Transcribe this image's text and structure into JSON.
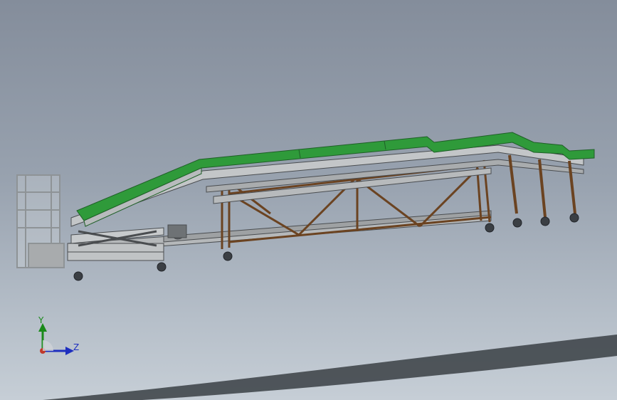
{
  "viewport": {
    "background_top": "#848d9b",
    "background_bottom": "#c6ced6",
    "floor_shadow_color": "#3a3f44"
  },
  "model": {
    "belt_color": "#2f9a3a",
    "frame_color": "#b9bcbe",
    "steel_color": "#8a5a2e",
    "railing_color": "#dfe3e6",
    "caster_color": "#3b3f44"
  },
  "triad": {
    "y_label": "Y",
    "z_label": "Z",
    "y_color": "#1a8a1a",
    "z_color": "#1e2fbf",
    "x_color": "#c0392b"
  }
}
